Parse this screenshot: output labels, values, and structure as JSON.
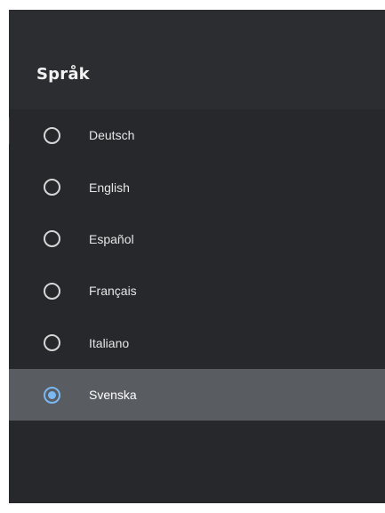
{
  "dialog": {
    "title": "Språk",
    "options": [
      {
        "label": "Deutsch",
        "selected": false
      },
      {
        "label": "English",
        "selected": false
      },
      {
        "label": "Español",
        "selected": false
      },
      {
        "label": "Français",
        "selected": false
      },
      {
        "label": "Italiano",
        "selected": false
      },
      {
        "label": "Svenska",
        "selected": true
      }
    ]
  },
  "colors": {
    "panel_background": "#27282c",
    "header_background": "#2c2d31",
    "selected_row": "#595c61",
    "accent": "#79b8f2",
    "text": "#e6e6e6"
  }
}
